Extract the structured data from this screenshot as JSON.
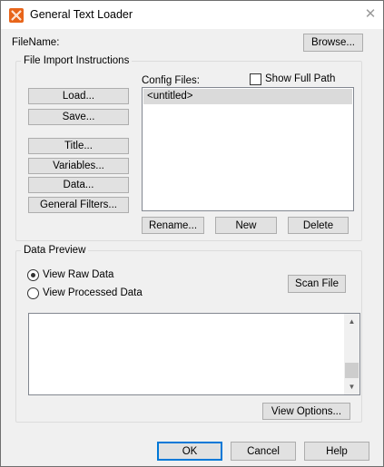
{
  "window": {
    "title": "General Text Loader"
  },
  "filename": {
    "label": "FileName:",
    "browse_label": "Browse..."
  },
  "import_group": {
    "legend": "File Import Instructions",
    "load_label": "Load...",
    "save_label": "Save...",
    "title_label": "Title...",
    "variables_label": "Variables...",
    "data_label": "Data...",
    "general_filters_label": "General Filters..."
  },
  "config": {
    "label": "Config Files:",
    "show_full_path_label": "Show Full Path",
    "show_full_path_checked": false,
    "items": [
      "<untitled>"
    ],
    "selected_index": 0,
    "rename_label": "Rename...",
    "new_label": "New",
    "delete_label": "Delete"
  },
  "preview_group": {
    "legend": "Data Preview",
    "view_raw_label": "View Raw Data",
    "view_processed_label": "View Processed Data",
    "selected_view": "View Raw Data",
    "scan_file_label": "Scan File",
    "view_options_label": "View Options..."
  },
  "footer": {
    "ok_label": "OK",
    "cancel_label": "Cancel",
    "help_label": "Help"
  },
  "colors": {
    "accent": "#0078d7",
    "dialog_bg": "#f0f0f0",
    "button_bg": "#e1e1e1",
    "selection": "#dadada",
    "icon_orange": "#e8651a"
  }
}
